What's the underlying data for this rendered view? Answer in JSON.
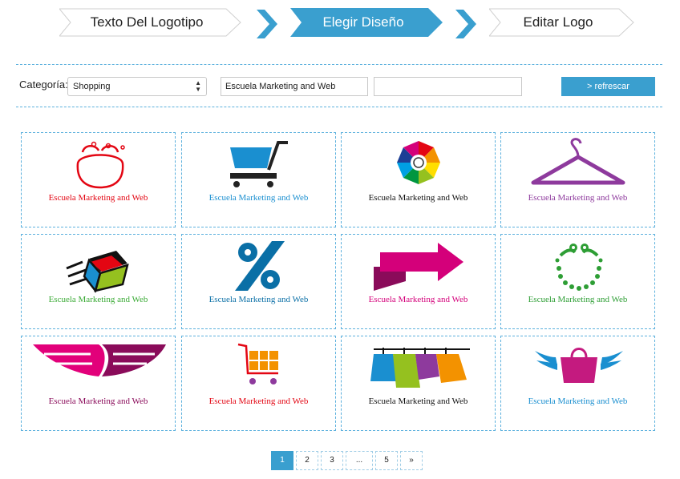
{
  "steps": {
    "step1": "Texto Del Logotipo",
    "step2": "Elegir Diseño",
    "step3": "Editar Logo"
  },
  "filter": {
    "category_label": "Categoría:",
    "category_value": "Shopping",
    "company_value": "Escuela Marketing and Web",
    "slogan_value": "",
    "refresh_label": "> refrescar"
  },
  "cards": [
    {
      "caption": "Escuela Marketing and Web",
      "color": "#e30613",
      "icon": "pot-icon"
    },
    {
      "caption": "Escuela Marketing and Web",
      "color": "#1a8fd0",
      "icon": "shopping-cart-icon"
    },
    {
      "caption": "Escuela Marketing and Web",
      "color": "#111111",
      "icon": "color-wheel-icon"
    },
    {
      "caption": "Escuela Marketing and Web",
      "color": "#8e3a9d",
      "icon": "hanger-icon"
    },
    {
      "caption": "Escuela Marketing and Web",
      "color": "#3aaa35",
      "icon": "flying-box-icon"
    },
    {
      "caption": "Escuela Marketing and Web",
      "color": "#0a6fa6",
      "icon": "percent-icon"
    },
    {
      "caption": "Escuela Marketing and Web",
      "color": "#d4007a",
      "icon": "arrow-icon"
    },
    {
      "caption": "Escuela Marketing and Web",
      "color": "#2e9e35",
      "icon": "dots-ring-icon"
    },
    {
      "caption": "Escuela Marketing and Web",
      "color": "#8a0b5a",
      "icon": "wings-icon"
    },
    {
      "caption": "Escuela Marketing and Web",
      "color": "#e30613",
      "icon": "cart-grid-icon"
    },
    {
      "caption": "Escuela Marketing and Web",
      "color": "#111111",
      "icon": "clothes-line-icon"
    },
    {
      "caption": "Escuela Marketing and Web",
      "color": "#1a8fd0",
      "icon": "winged-bag-icon"
    }
  ],
  "pagination": [
    "1",
    "2",
    "3",
    "...",
    "5",
    "»"
  ],
  "current_page": "1"
}
